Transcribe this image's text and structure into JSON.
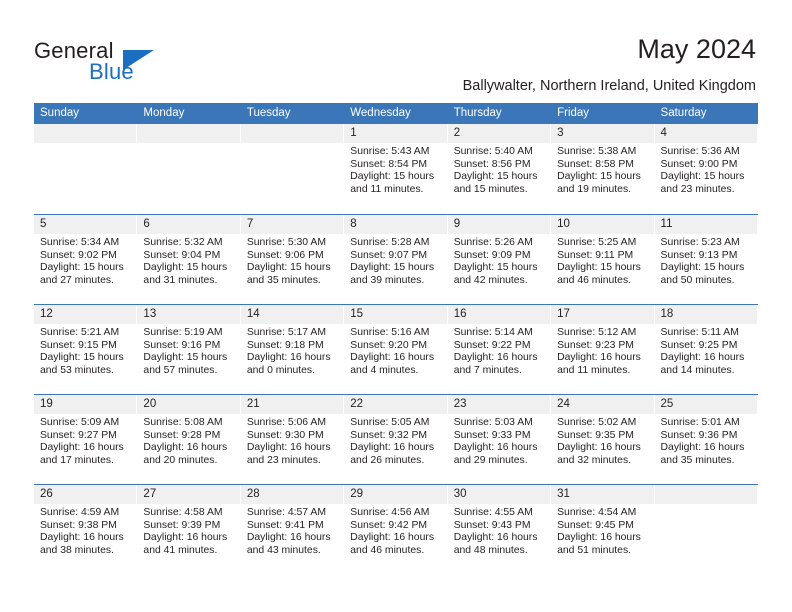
{
  "brand": {
    "name_part1": "General",
    "name_part2": "Blue",
    "accent_color": "#1b6fc1"
  },
  "header": {
    "title": "May 2024",
    "location": "Ballywalter, Northern Ireland, United Kingdom"
  },
  "calendar": {
    "header_bg_color": "#3b76b8",
    "day_band_color": "#f0f0f0",
    "weekday_headers": [
      "Sunday",
      "Monday",
      "Tuesday",
      "Wednesday",
      "Thursday",
      "Friday",
      "Saturday"
    ],
    "weeks": [
      [
        {
          "day": "",
          "lines": []
        },
        {
          "day": "",
          "lines": []
        },
        {
          "day": "",
          "lines": []
        },
        {
          "day": "1",
          "lines": [
            "Sunrise: 5:43 AM",
            "Sunset: 8:54 PM",
            "Daylight: 15 hours",
            "and 11 minutes."
          ]
        },
        {
          "day": "2",
          "lines": [
            "Sunrise: 5:40 AM",
            "Sunset: 8:56 PM",
            "Daylight: 15 hours",
            "and 15 minutes."
          ]
        },
        {
          "day": "3",
          "lines": [
            "Sunrise: 5:38 AM",
            "Sunset: 8:58 PM",
            "Daylight: 15 hours",
            "and 19 minutes."
          ]
        },
        {
          "day": "4",
          "lines": [
            "Sunrise: 5:36 AM",
            "Sunset: 9:00 PM",
            "Daylight: 15 hours",
            "and 23 minutes."
          ]
        }
      ],
      [
        {
          "day": "5",
          "lines": [
            "Sunrise: 5:34 AM",
            "Sunset: 9:02 PM",
            "Daylight: 15 hours",
            "and 27 minutes."
          ]
        },
        {
          "day": "6",
          "lines": [
            "Sunrise: 5:32 AM",
            "Sunset: 9:04 PM",
            "Daylight: 15 hours",
            "and 31 minutes."
          ]
        },
        {
          "day": "7",
          "lines": [
            "Sunrise: 5:30 AM",
            "Sunset: 9:06 PM",
            "Daylight: 15 hours",
            "and 35 minutes."
          ]
        },
        {
          "day": "8",
          "lines": [
            "Sunrise: 5:28 AM",
            "Sunset: 9:07 PM",
            "Daylight: 15 hours",
            "and 39 minutes."
          ]
        },
        {
          "day": "9",
          "lines": [
            "Sunrise: 5:26 AM",
            "Sunset: 9:09 PM",
            "Daylight: 15 hours",
            "and 42 minutes."
          ]
        },
        {
          "day": "10",
          "lines": [
            "Sunrise: 5:25 AM",
            "Sunset: 9:11 PM",
            "Daylight: 15 hours",
            "and 46 minutes."
          ]
        },
        {
          "day": "11",
          "lines": [
            "Sunrise: 5:23 AM",
            "Sunset: 9:13 PM",
            "Daylight: 15 hours",
            "and 50 minutes."
          ]
        }
      ],
      [
        {
          "day": "12",
          "lines": [
            "Sunrise: 5:21 AM",
            "Sunset: 9:15 PM",
            "Daylight: 15 hours",
            "and 53 minutes."
          ]
        },
        {
          "day": "13",
          "lines": [
            "Sunrise: 5:19 AM",
            "Sunset: 9:16 PM",
            "Daylight: 15 hours",
            "and 57 minutes."
          ]
        },
        {
          "day": "14",
          "lines": [
            "Sunrise: 5:17 AM",
            "Sunset: 9:18 PM",
            "Daylight: 16 hours",
            "and 0 minutes."
          ]
        },
        {
          "day": "15",
          "lines": [
            "Sunrise: 5:16 AM",
            "Sunset: 9:20 PM",
            "Daylight: 16 hours",
            "and 4 minutes."
          ]
        },
        {
          "day": "16",
          "lines": [
            "Sunrise: 5:14 AM",
            "Sunset: 9:22 PM",
            "Daylight: 16 hours",
            "and 7 minutes."
          ]
        },
        {
          "day": "17",
          "lines": [
            "Sunrise: 5:12 AM",
            "Sunset: 9:23 PM",
            "Daylight: 16 hours",
            "and 11 minutes."
          ]
        },
        {
          "day": "18",
          "lines": [
            "Sunrise: 5:11 AM",
            "Sunset: 9:25 PM",
            "Daylight: 16 hours",
            "and 14 minutes."
          ]
        }
      ],
      [
        {
          "day": "19",
          "lines": [
            "Sunrise: 5:09 AM",
            "Sunset: 9:27 PM",
            "Daylight: 16 hours",
            "and 17 minutes."
          ]
        },
        {
          "day": "20",
          "lines": [
            "Sunrise: 5:08 AM",
            "Sunset: 9:28 PM",
            "Daylight: 16 hours",
            "and 20 minutes."
          ]
        },
        {
          "day": "21",
          "lines": [
            "Sunrise: 5:06 AM",
            "Sunset: 9:30 PM",
            "Daylight: 16 hours",
            "and 23 minutes."
          ]
        },
        {
          "day": "22",
          "lines": [
            "Sunrise: 5:05 AM",
            "Sunset: 9:32 PM",
            "Daylight: 16 hours",
            "and 26 minutes."
          ]
        },
        {
          "day": "23",
          "lines": [
            "Sunrise: 5:03 AM",
            "Sunset: 9:33 PM",
            "Daylight: 16 hours",
            "and 29 minutes."
          ]
        },
        {
          "day": "24",
          "lines": [
            "Sunrise: 5:02 AM",
            "Sunset: 9:35 PM",
            "Daylight: 16 hours",
            "and 32 minutes."
          ]
        },
        {
          "day": "25",
          "lines": [
            "Sunrise: 5:01 AM",
            "Sunset: 9:36 PM",
            "Daylight: 16 hours",
            "and 35 minutes."
          ]
        }
      ],
      [
        {
          "day": "26",
          "lines": [
            "Sunrise: 4:59 AM",
            "Sunset: 9:38 PM",
            "Daylight: 16 hours",
            "and 38 minutes."
          ]
        },
        {
          "day": "27",
          "lines": [
            "Sunrise: 4:58 AM",
            "Sunset: 9:39 PM",
            "Daylight: 16 hours",
            "and 41 minutes."
          ]
        },
        {
          "day": "28",
          "lines": [
            "Sunrise: 4:57 AM",
            "Sunset: 9:41 PM",
            "Daylight: 16 hours",
            "and 43 minutes."
          ]
        },
        {
          "day": "29",
          "lines": [
            "Sunrise: 4:56 AM",
            "Sunset: 9:42 PM",
            "Daylight: 16 hours",
            "and 46 minutes."
          ]
        },
        {
          "day": "30",
          "lines": [
            "Sunrise: 4:55 AM",
            "Sunset: 9:43 PM",
            "Daylight: 16 hours",
            "and 48 minutes."
          ]
        },
        {
          "day": "31",
          "lines": [
            "Sunrise: 4:54 AM",
            "Sunset: 9:45 PM",
            "Daylight: 16 hours",
            "and 51 minutes."
          ]
        },
        {
          "day": "",
          "lines": []
        }
      ]
    ]
  }
}
